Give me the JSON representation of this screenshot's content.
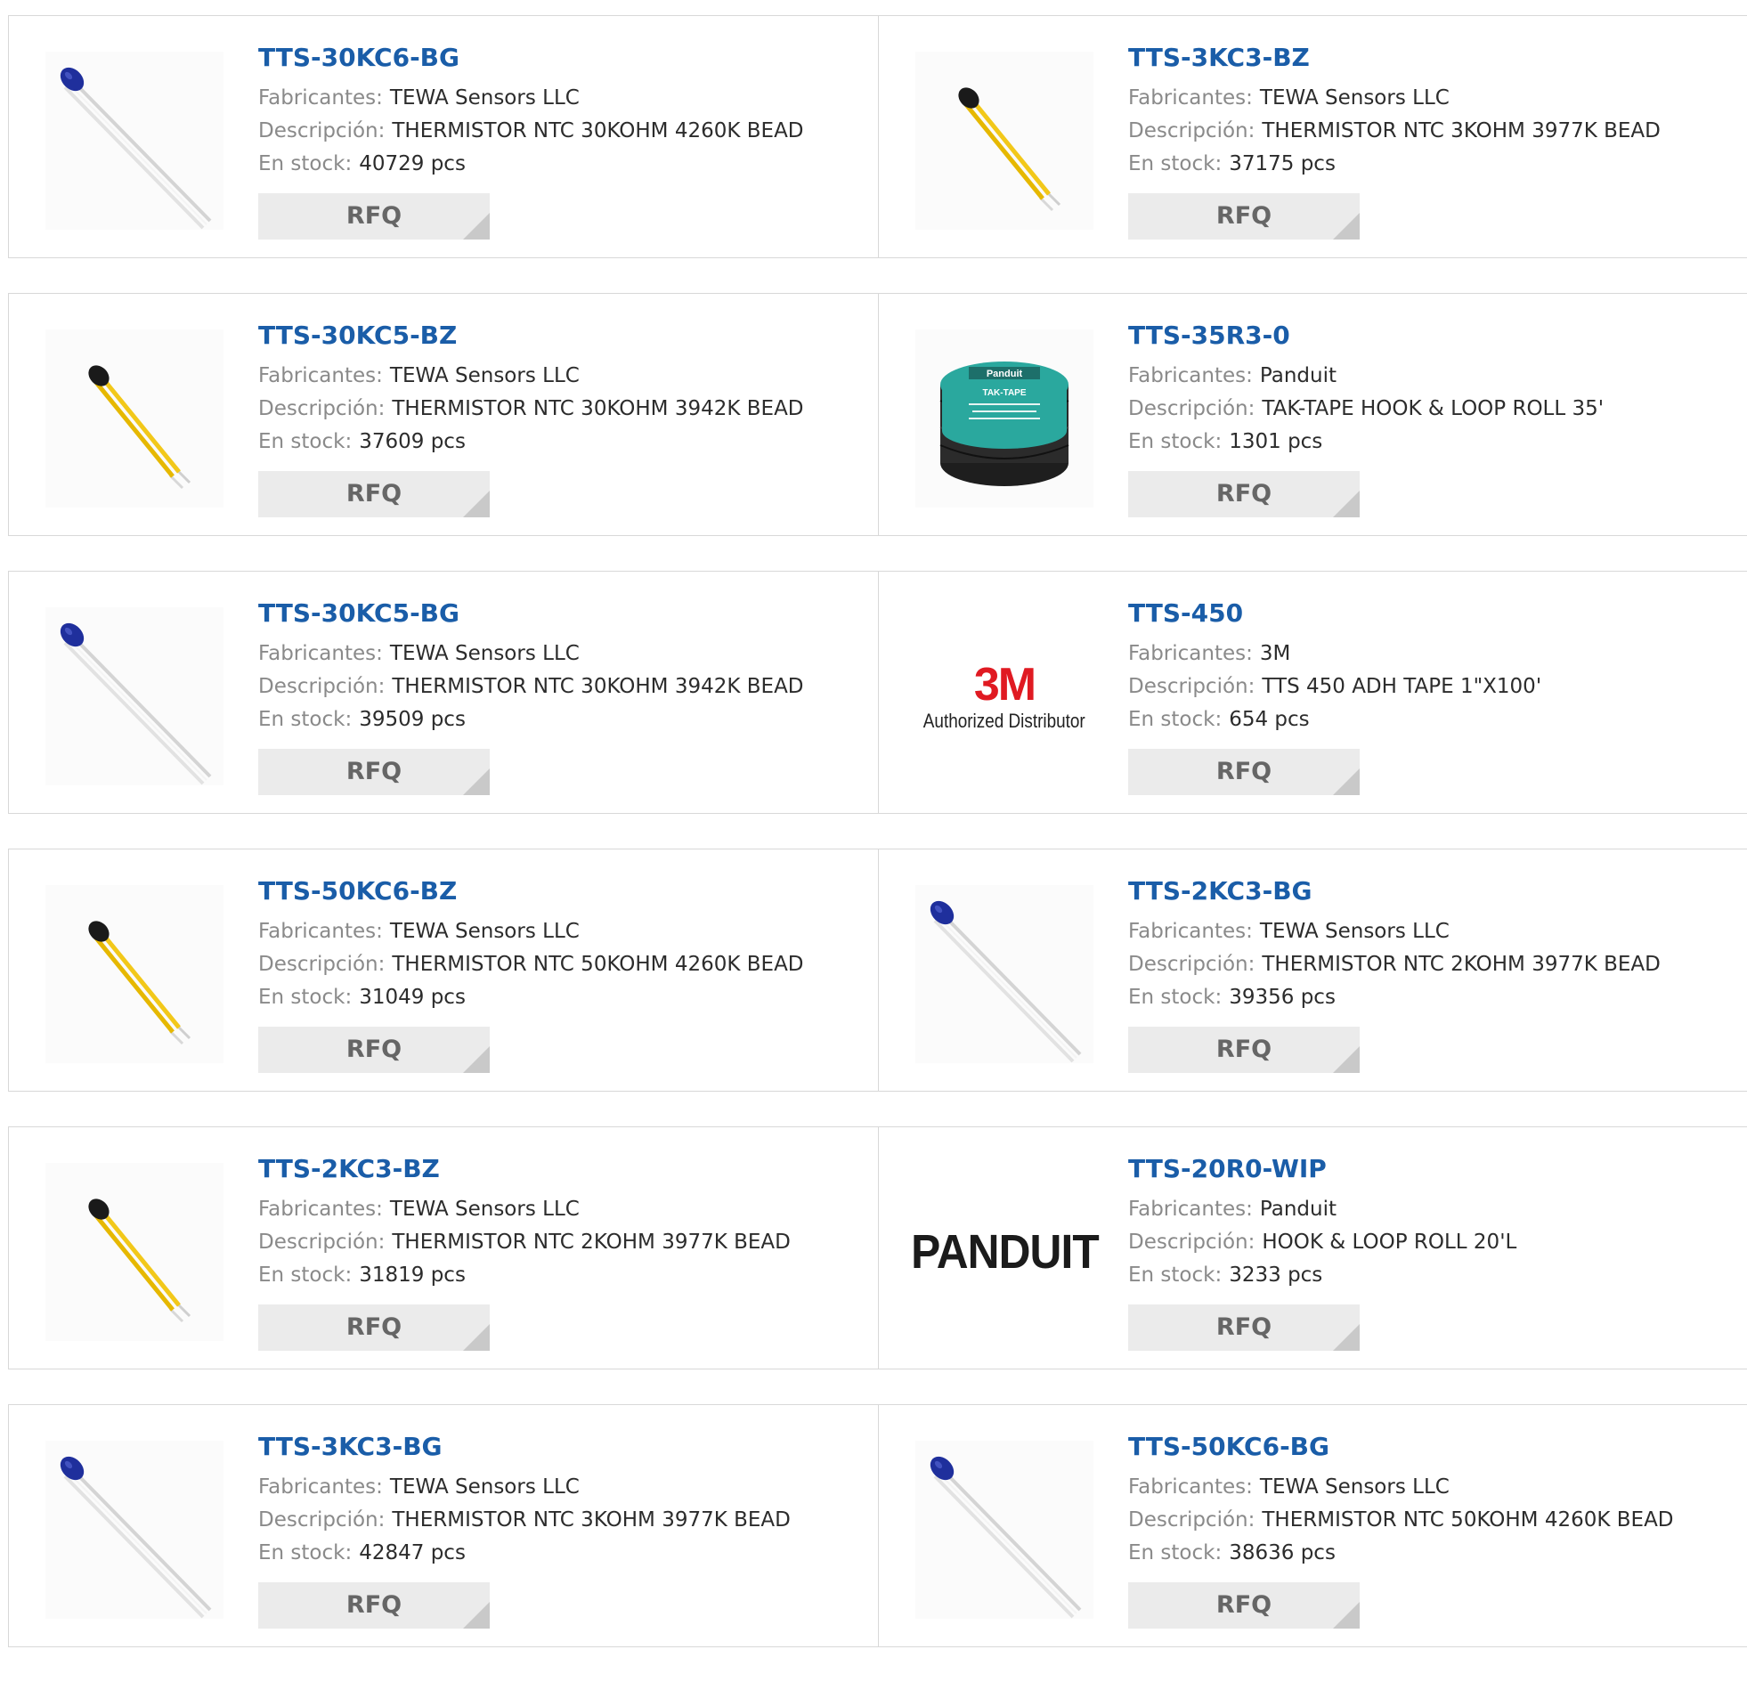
{
  "labels": {
    "manufacturer": "Fabricantes:",
    "description": "Descripción:",
    "stock": "En stock:",
    "rfq": "RFQ"
  },
  "products": [
    {
      "pn": "TTS-30KC6-BG",
      "manufacturer": "TEWA Sensors LLC",
      "description": "THERMISTOR NTC 30KOHM 4260K BEAD",
      "stock": "40729 pcs",
      "image": "thermistor-blue-icon"
    },
    {
      "pn": "TTS-3KC3-BZ",
      "manufacturer": "TEWA Sensors LLC",
      "description": "THERMISTOR NTC 3KOHM 3977K BEAD",
      "stock": "37175 pcs",
      "image": "thermistor-yellow-icon"
    },
    {
      "pn": "TTS-30KC5-BZ",
      "manufacturer": "TEWA Sensors LLC",
      "description": "THERMISTOR NTC 30KOHM 3942K BEAD",
      "stock": "37609 pcs",
      "image": "thermistor-yellow-icon"
    },
    {
      "pn": "TTS-35R3-0",
      "manufacturer": "Panduit",
      "description": "TAK-TAPE HOOK & LOOP ROLL 35'",
      "stock": "1301 pcs",
      "image": "tape-roll-icon",
      "tape_brand": "Panduit",
      "tape_label": "TAK-TAPE"
    },
    {
      "pn": "TTS-30KC5-BG",
      "manufacturer": "TEWA Sensors LLC",
      "description": "THERMISTOR NTC 30KOHM 3942K BEAD",
      "stock": "39509 pcs",
      "image": "thermistor-blue-icon"
    },
    {
      "pn": "TTS-450",
      "manufacturer": "3M",
      "description": "TTS 450 ADH TAPE 1\"X100'",
      "stock": "654 pcs",
      "image": "3m-logo",
      "logo_mark": "3M",
      "logo_sub": "Authorized Distributor"
    },
    {
      "pn": "TTS-50KC6-BZ",
      "manufacturer": "TEWA Sensors LLC",
      "description": "THERMISTOR NTC 50KOHM 4260K BEAD",
      "stock": "31049 pcs",
      "image": "thermistor-yellow-icon"
    },
    {
      "pn": "TTS-2KC3-BG",
      "manufacturer": "TEWA Sensors LLC",
      "description": "THERMISTOR NTC 2KOHM 3977K BEAD",
      "stock": "39356 pcs",
      "image": "thermistor-blue-icon"
    },
    {
      "pn": "TTS-2KC3-BZ",
      "manufacturer": "TEWA Sensors LLC",
      "description": "THERMISTOR NTC 2KOHM 3977K BEAD",
      "stock": "31819 pcs",
      "image": "thermistor-yellow-icon"
    },
    {
      "pn": "TTS-20R0-WIP",
      "manufacturer": "Panduit",
      "description": "HOOK & LOOP ROLL 20'L",
      "stock": "3233 pcs",
      "image": "panduit-logo",
      "logo_mark": "PANDUIT"
    },
    {
      "pn": "TTS-3KC3-BG",
      "manufacturer": "TEWA Sensors LLC",
      "description": "THERMISTOR NTC 3KOHM 3977K BEAD",
      "stock": "42847 pcs",
      "image": "thermistor-blue-icon"
    },
    {
      "pn": "TTS-50KC6-BG",
      "manufacturer": "TEWA Sensors LLC",
      "description": "THERMISTOR NTC 50KOHM 4260K BEAD",
      "stock": "38636 pcs",
      "image": "thermistor-blue-icon"
    }
  ],
  "colors": {
    "link": "#1a5da8",
    "label": "#8a8a8a",
    "value": "#2c2c2c",
    "rfq_bg": "#ebebeb",
    "border": "#d8d8d8",
    "bead_blue": "#1f2f9c",
    "lead_yellow": "#f2c81a",
    "logo_3m": "#e01a22",
    "tape_teal": "#2aa89e"
  }
}
